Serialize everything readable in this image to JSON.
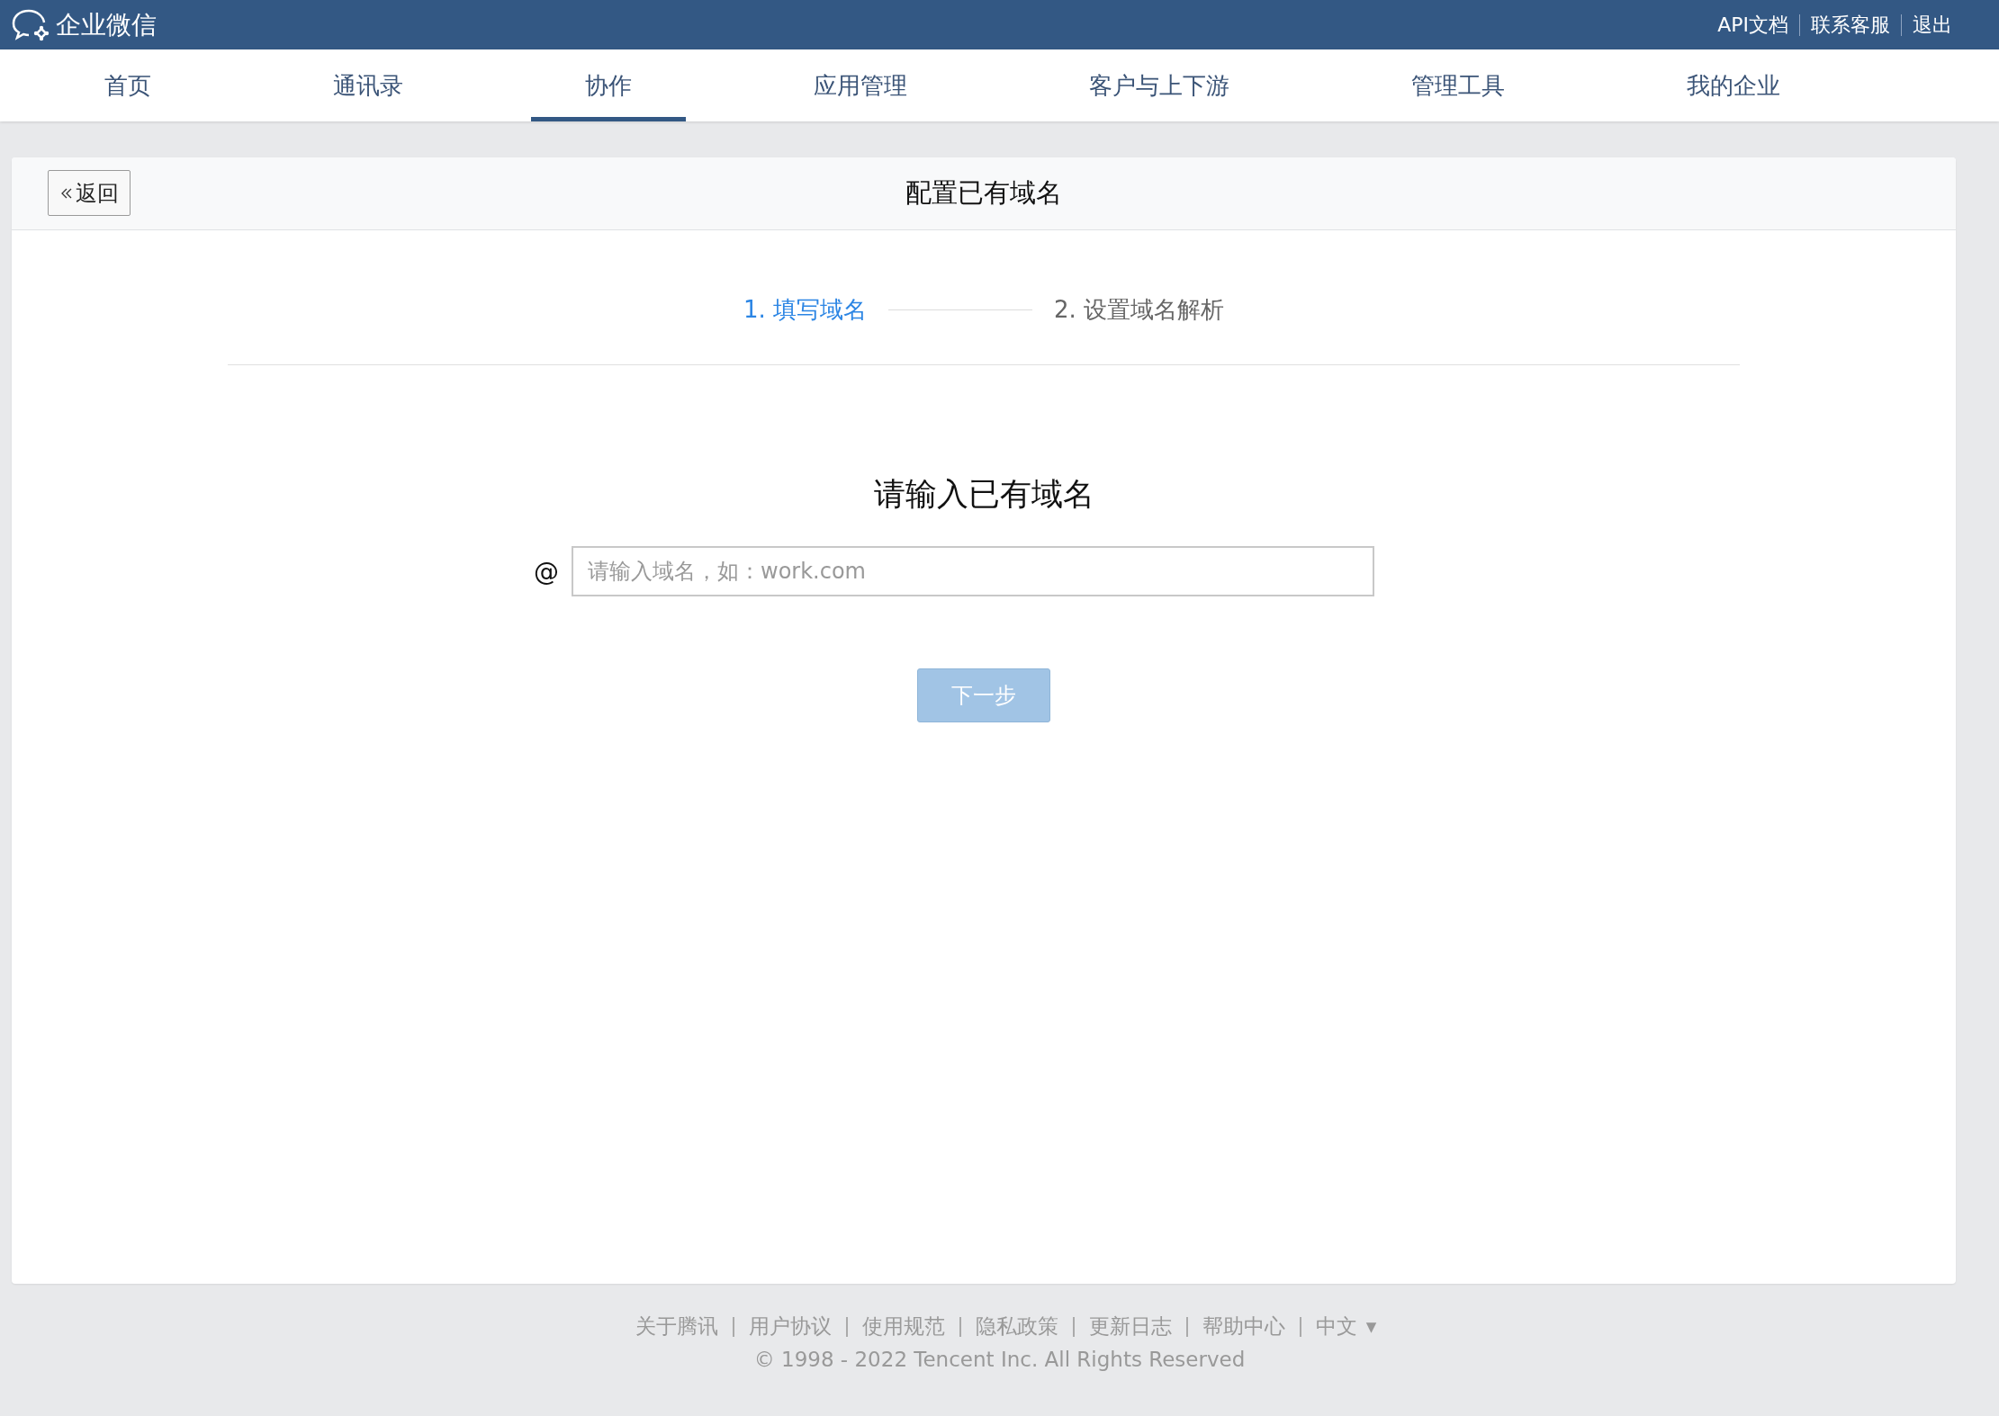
{
  "top_bar": {
    "brand": "企业微信",
    "links": [
      "API文档",
      "联系客服",
      "退出"
    ]
  },
  "nav_tabs": [
    {
      "label": "首页",
      "selected": false
    },
    {
      "label": "通讯录",
      "selected": false
    },
    {
      "label": "协作",
      "selected": true
    },
    {
      "label": "应用管理",
      "selected": false
    },
    {
      "label": "客户与上下游",
      "selected": false
    },
    {
      "label": "管理工具",
      "selected": false
    },
    {
      "label": "我的企业",
      "selected": false
    }
  ],
  "panel": {
    "back_button": "返回",
    "title": "配置已有域名",
    "steps": [
      {
        "label": "1. 填写域名",
        "selected": true
      },
      {
        "label": "2. 设置域名解析",
        "selected": false
      }
    ],
    "heading": "请输入已有域名",
    "prefix": "@",
    "domain_field": {
      "placeholder": "请输入域名，如：work.com"
    },
    "next_button": {
      "label": "下一步",
      "disabled": true
    }
  },
  "footer": {
    "links": [
      "关于腾讯",
      "用户协议",
      "使用规范",
      "隐私政策",
      "更新日志",
      "帮助中心"
    ],
    "language": {
      "label": "中文",
      "caret": "▼"
    },
    "copyright": "© 1998 - 2022 Tencent Inc. All Rights Reserved"
  }
}
